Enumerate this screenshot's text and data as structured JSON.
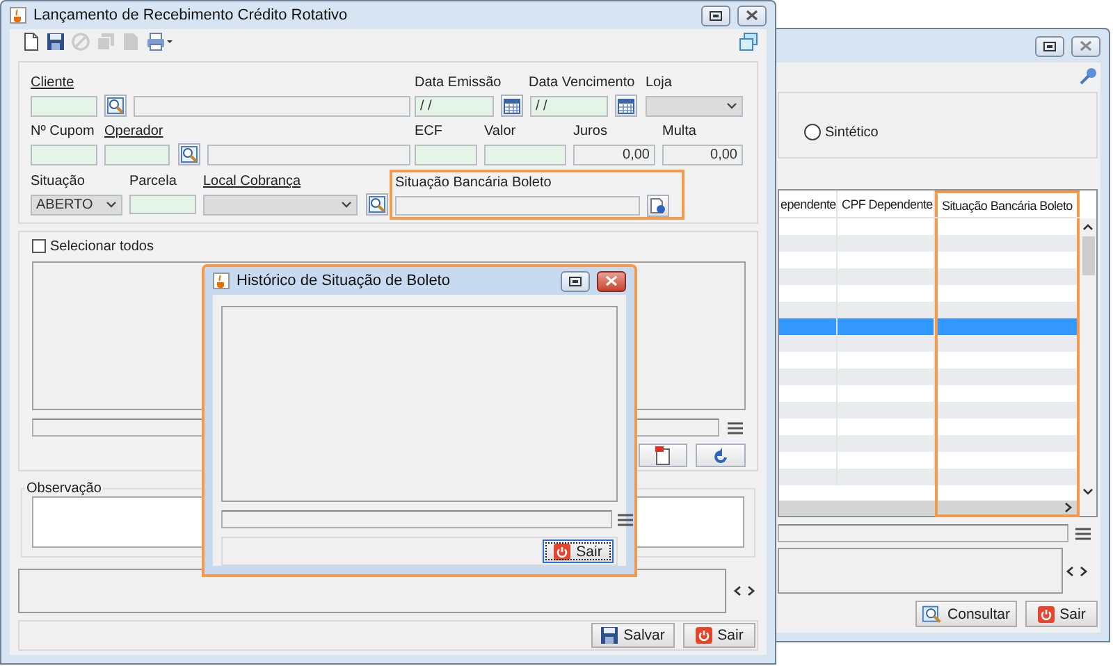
{
  "back_window": {
    "search_mode": {
      "label": "Sintético",
      "selected": false
    },
    "table": {
      "columns": [
        {
          "label": "ependente",
          "highlighted": false
        },
        {
          "label": "CPF Dependente",
          "highlighted": false
        },
        {
          "label": "Situação Bancária Boleto",
          "highlighted": true
        }
      ],
      "rows": [
        {
          "selected": false
        },
        {
          "selected": false
        },
        {
          "selected": false
        },
        {
          "selected": false
        },
        {
          "selected": false
        },
        {
          "selected": false
        },
        {
          "selected": true
        },
        {
          "selected": false
        },
        {
          "selected": false
        },
        {
          "selected": false
        },
        {
          "selected": false
        },
        {
          "selected": false
        },
        {
          "selected": false
        },
        {
          "selected": false
        },
        {
          "selected": false
        },
        {
          "selected": false
        }
      ]
    },
    "buttons": [
      {
        "label": "Consultar",
        "kind": "search"
      },
      {
        "label": "Sair",
        "kind": "exit"
      }
    ]
  },
  "main_window": {
    "title": "Lançamento de Recebimento Crédito Rotativo",
    "toolbar": [
      {
        "kind": "new",
        "disabled": false
      },
      {
        "kind": "save",
        "disabled": false
      },
      {
        "kind": "cancel",
        "disabled": true
      },
      {
        "kind": "copy",
        "disabled": true
      },
      {
        "kind": "document",
        "disabled": true
      },
      {
        "kind": "print",
        "disabled": false
      }
    ],
    "form": {
      "cliente": {
        "label": "Cliente",
        "link": true,
        "code": {
          "editable": true
        },
        "name": {
          "editable": false
        }
      },
      "data_emissao": {
        "label": "Data Emissão",
        "link": false,
        "value": "/ /",
        "editable": true
      },
      "data_vencimento": {
        "label": "Data Vencimento",
        "link": false,
        "value": "/ /",
        "editable": true
      },
      "loja": {
        "label": "Loja",
        "link": false,
        "editable": false
      },
      "cupom": {
        "label": "Nº Cupom",
        "link": false,
        "editable": true
      },
      "operador": {
        "label": "Operador",
        "link": true,
        "code": {
          "editable": true
        },
        "name": {
          "editable": false
        }
      },
      "ecf": {
        "label": "ECF",
        "link": false,
        "editable": true
      },
      "valor": {
        "label": "Valor",
        "link": false,
        "editable": true
      },
      "juros": {
        "label": "Juros",
        "link": false,
        "value": "0,00",
        "editable": false
      },
      "multa": {
        "label": "Multa",
        "link": false,
        "value": "0,00",
        "editable": false
      },
      "situacao": {
        "label": "Situação",
        "link": false,
        "value": "ABERTO",
        "editable": false
      },
      "parcela": {
        "label": "Parcela",
        "link": false,
        "editable": true
      },
      "local_cobranca": {
        "label": "Local Cobrança",
        "link": true,
        "editable": false
      },
      "situacao_bancaria": {
        "label": "Situação Bancária Boleto",
        "link": false,
        "editable": false,
        "highlighted": true
      }
    },
    "select_all": {
      "label": "Selecionar todos",
      "checked": false
    },
    "observation": {
      "label": "Observação"
    },
    "buttons": [
      {
        "label": "Salvar",
        "kind": "save"
      },
      {
        "label": "Sair",
        "kind": "exit"
      }
    ]
  },
  "dialog": {
    "title": "Histórico de Situação de Boleto",
    "highlighted": true,
    "buttons": [
      {
        "label": "Sair",
        "kind": "exit",
        "focused": true
      }
    ]
  }
}
